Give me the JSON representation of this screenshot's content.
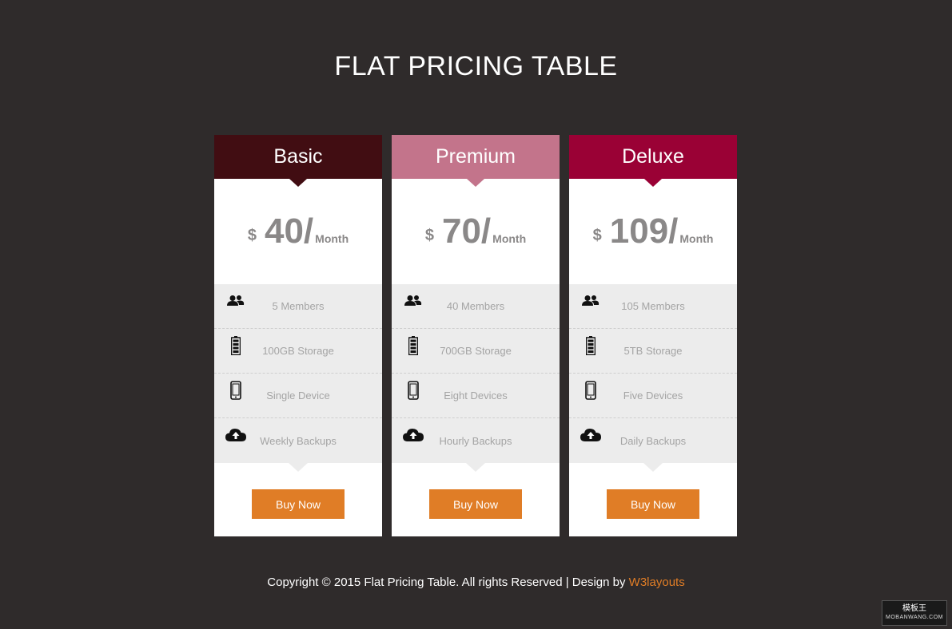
{
  "page": {
    "title": "FLAT PRICING TABLE"
  },
  "colors": {
    "background": "#2f2b2b",
    "basic": "#410d12",
    "premium": "#c3748b",
    "deluxe": "#9a0135",
    "button": "#e07d26",
    "features_bg": "#ececec"
  },
  "plans": [
    {
      "name": "Basic",
      "currency": "$",
      "amount": "40/",
      "period": "Month",
      "features": [
        {
          "icon": "users-icon",
          "text": "5 Members"
        },
        {
          "icon": "battery-icon",
          "text": "100GB Storage"
        },
        {
          "icon": "phone-icon",
          "text": "Single Device"
        },
        {
          "icon": "cloud-upload-icon",
          "text": "Weekly Backups"
        }
      ],
      "button": "Buy Now"
    },
    {
      "name": "Premium",
      "currency": "$",
      "amount": "70/",
      "period": "Month",
      "features": [
        {
          "icon": "users-icon",
          "text": "40 Members"
        },
        {
          "icon": "battery-icon",
          "text": "700GB Storage"
        },
        {
          "icon": "phone-icon",
          "text": "Eight Devices"
        },
        {
          "icon": "cloud-upload-icon",
          "text": "Hourly Backups"
        }
      ],
      "button": "Buy Now"
    },
    {
      "name": "Deluxe",
      "currency": "$",
      "amount": "109/",
      "period": "Month",
      "features": [
        {
          "icon": "users-icon",
          "text": "105 Members"
        },
        {
          "icon": "battery-icon",
          "text": "5TB Storage"
        },
        {
          "icon": "phone-icon",
          "text": "Five Devices"
        },
        {
          "icon": "cloud-upload-icon",
          "text": "Daily Backups"
        }
      ],
      "button": "Buy Now"
    }
  ],
  "footer": {
    "text": "Copyright © 2015 Flat Pricing Table. All rights Reserved | Design by ",
    "link": "W3layouts"
  },
  "watermark": {
    "name": "模板王",
    "site": "MOBANWANG.COM"
  }
}
